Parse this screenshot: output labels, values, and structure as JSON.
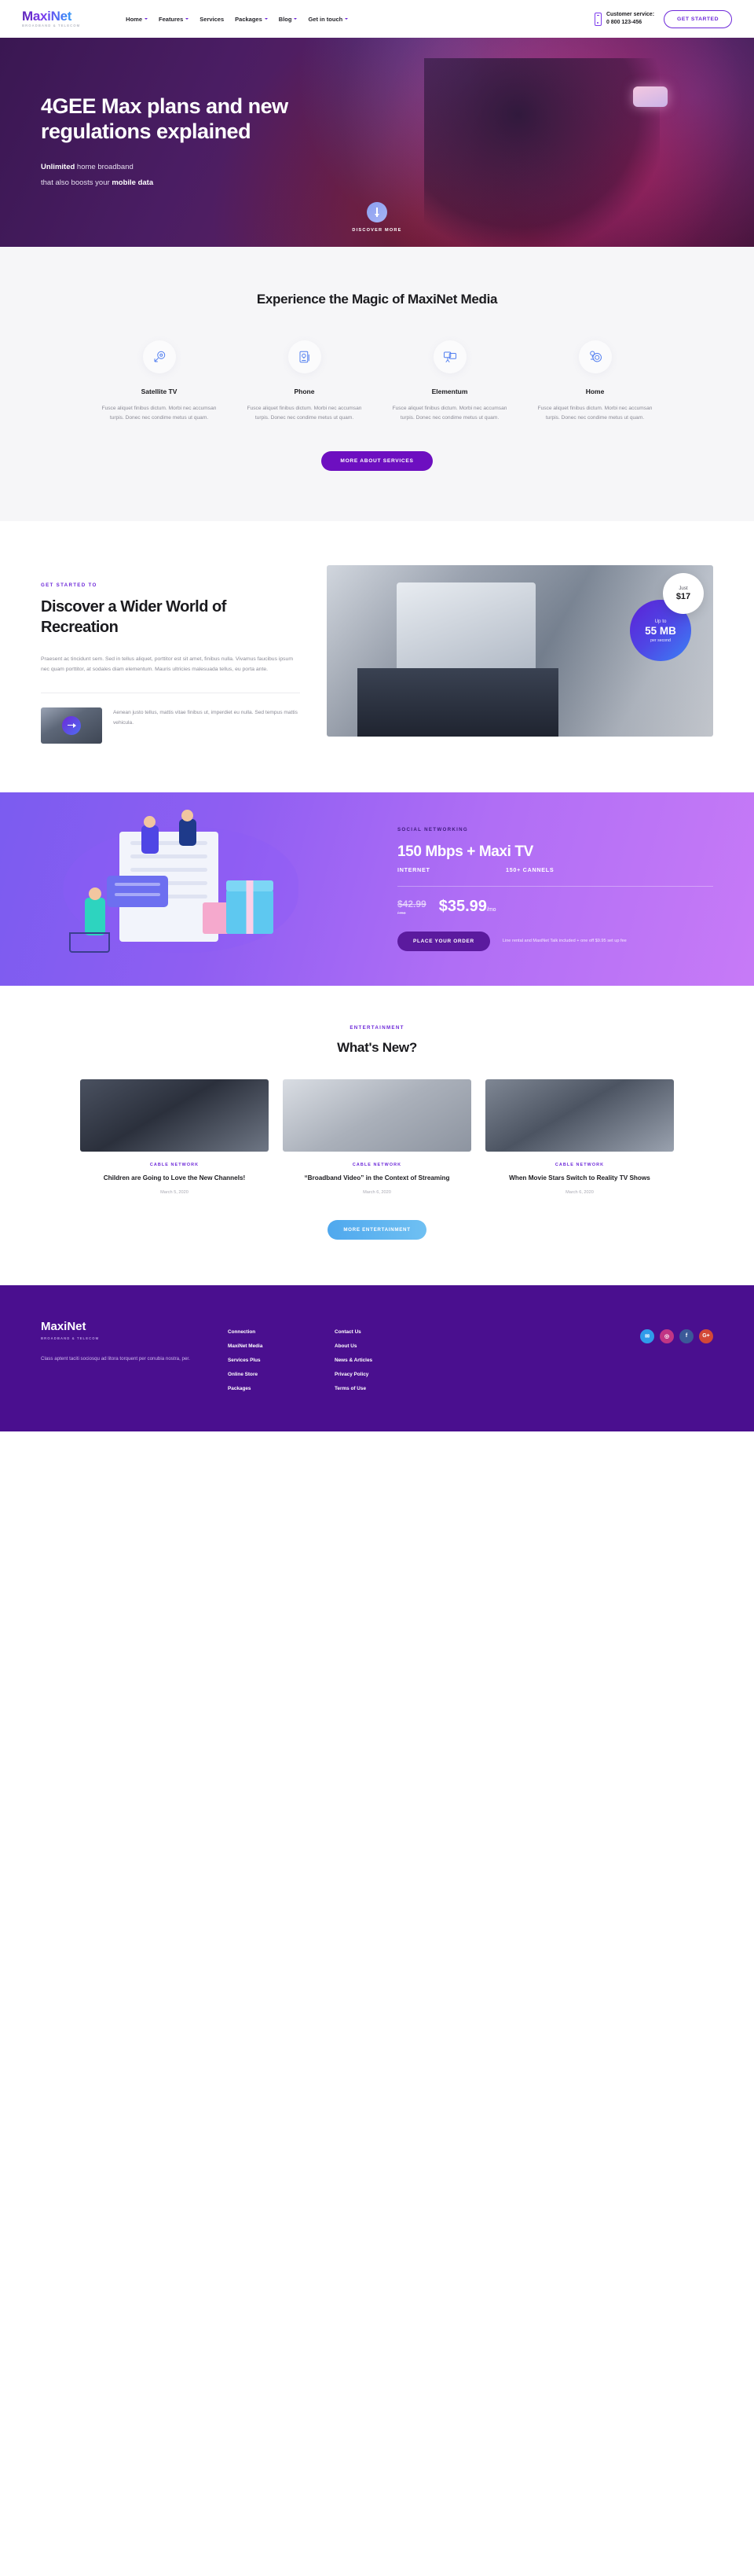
{
  "header": {
    "logo": "MaxiNet",
    "logo_sub": "BROADBAND & TELECOM",
    "nav": [
      {
        "label": "Home",
        "caret": true
      },
      {
        "label": "Features",
        "caret": true
      },
      {
        "label": "Services",
        "caret": false
      },
      {
        "label": "Packages",
        "caret": true
      },
      {
        "label": "Blog",
        "caret": true
      },
      {
        "label": "Get in touch",
        "caret": true
      }
    ],
    "customer_service_label": "Customer service:",
    "customer_service_phone": "0 800 123-456",
    "cta": "GET STARTED"
  },
  "hero": {
    "title": "4GEE Max plans and new regulations explained",
    "sub_line1_bold": "Unlimited",
    "sub_line1_rest": "home broadband",
    "sub_line2_rest": "that also boosts your",
    "sub_line2_bold": "mobile data",
    "scroll_label": "DISCOVER MORE"
  },
  "services": {
    "title": "Experience the Magic of MaxiNet Media",
    "cards": [
      {
        "title": "Satellite TV",
        "text": "Fusce aliquet finibus dictum. Morbi nec accumsan turpis. Donec nec condime metus ut quam.",
        "icon": "satellite-dish-icon"
      },
      {
        "title": "Phone",
        "text": "Fusce aliquet finibus dictum. Morbi nec accumsan turpis. Donec nec condime metus ut quam.",
        "icon": "document-idea-icon"
      },
      {
        "title": "Elementum",
        "text": "Fusce aliquet finibus dictum. Morbi nec accumsan turpis. Donec nec condime metus ut quam.",
        "icon": "chat-presentation-icon"
      },
      {
        "title": "Home",
        "text": "Fusce aliquet finibus dictum. Morbi nec accumsan turpis. Donec nec condime metus ut quam.",
        "icon": "idea-target-icon"
      }
    ],
    "button": "MORE ABOUT SERVICES"
  },
  "discover": {
    "eyebrow": "GET STARTED TO",
    "title": "Discover a Wider World of Recreation",
    "paragraph": "Praesent ac tincidunt sem. Sed in tellus aliquet, porttitor est sit amet, finibus nulla. Vivamus faucibus ipsum nec quam porttitor, at sodales diam elementum. Mauris ultricies malesuada tellus, eu porta ante.",
    "mini_text": "Aenean justo tellus, mattis vitae finibus ut, imperdiet eu nulla. Sed tempus mattis vehicula.",
    "badge_white_small": "Just",
    "badge_white_big": "$17",
    "badge_purple_small": "Up to",
    "badge_purple_big": "55 MB",
    "badge_purple_tiny": "per second"
  },
  "promo": {
    "eyebrow": "SOCIAL NETWORKING",
    "title": "150 Mbps + Maxi TV",
    "meta_left": "INTERNET",
    "meta_right": "150+ CANNELS",
    "old_price": "$42.99",
    "old_unit": "/ mo",
    "new_price": "$35.99",
    "new_unit": "/mo",
    "button": "PLACE YOUR ORDER",
    "note": "Line rental and MaxiNet Talk included + one off $9.95 set up fee"
  },
  "news": {
    "eyebrow": "ENTERTAINMENT",
    "title": "What's New?",
    "posts": [
      {
        "tag": "CABLE NETWORK",
        "title": "Children are Going to Love the New Channels!",
        "date": "March 5, 2020"
      },
      {
        "tag": "CABLE NETWORK",
        "title": "“Broadband Video” in the Context of Streaming",
        "date": "March 6, 2020"
      },
      {
        "tag": "CABLE NETWORK",
        "title": "When Movie Stars Switch to Reality TV Shows",
        "date": "March 6, 2020"
      }
    ],
    "button": "MORE ENTERTAINMENT"
  },
  "footer": {
    "logo": "MaxiNet",
    "logo_sub": "BROADBAND & TELECOM",
    "desc": "Class aptent taciti sociosqu ad litora torquent per conubia nostra, per.",
    "col1": [
      "Connection",
      "MaxiNet Media",
      "Services Plus",
      "Online Store",
      "Packages"
    ],
    "col2": [
      "Contact Us",
      "About Us",
      "News & Articles",
      "Privacy Policy",
      "Terms of Use"
    ],
    "social": [
      {
        "name": "twitter",
        "glyph": "✉",
        "color": "#2f9bea"
      },
      {
        "name": "instagram",
        "glyph": "◎",
        "color": "#c13584"
      },
      {
        "name": "facebook",
        "glyph": "f",
        "color": "#3b5998"
      },
      {
        "name": "google-plus",
        "glyph": "G+",
        "color": "#d34836"
      }
    ]
  },
  "colors": {
    "brand_purple": "#6d28d9",
    "deep_purple": "#4a0f8f",
    "accent_blue": "#4fa8ee"
  }
}
